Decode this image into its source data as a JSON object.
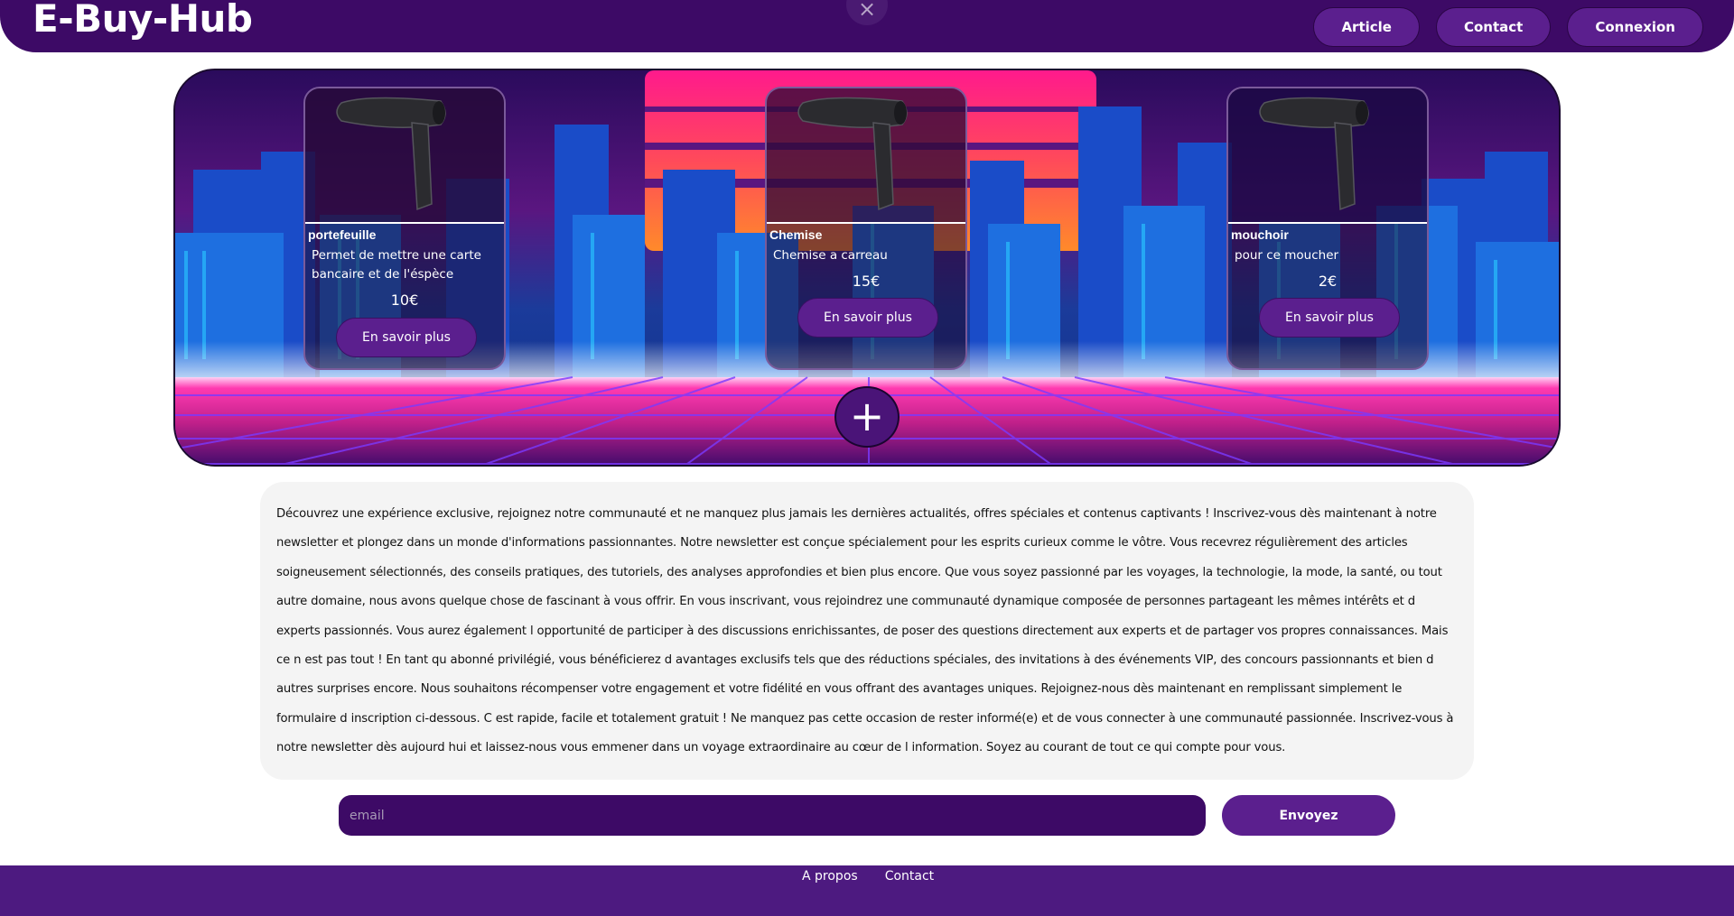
{
  "header": {
    "logo": "E-Buy-Hub",
    "close_symbol": "×",
    "nav": [
      {
        "label": "Article"
      },
      {
        "label": "Contact"
      },
      {
        "label": "Connexion"
      }
    ]
  },
  "products": [
    {
      "title": "portefeuille",
      "description": "Permet de mettre une carte bancaire et de l'éspèce",
      "price": "10€",
      "button": "En savoir plus"
    },
    {
      "title": "Chemise",
      "description": "Chemise a carreau",
      "price": "15€",
      "button": "En savoir plus"
    },
    {
      "title": "mouchoir",
      "description": "pour ce moucher",
      "price": "2€",
      "button": "En savoir plus"
    }
  ],
  "hero": {
    "plus_symbol": "+"
  },
  "newsletter": {
    "text": "Découvrez une expérience exclusive, rejoignez notre communauté et ne manquez plus jamais les dernières actualités, offres spéciales et contenus captivants ! Inscrivez-vous dès maintenant à notre newsletter et plongez dans un monde d'informations passionnantes. Notre newsletter est conçue spécialement pour les esprits curieux comme le vôtre. Vous recevrez régulièrement des articles soigneusement sélectionnés, des conseils pratiques, des tutoriels, des analyses approfondies et bien plus encore. Que vous soyez passionné par les voyages, la technologie, la mode, la santé, ou tout autre domaine, nous avons quelque chose de fascinant à vous offrir. En vous inscrivant, vous rejoindrez une communauté dynamique composée de personnes partageant les mêmes intérêts et d experts passionnés. Vous aurez également l opportunité de participer à des discussions enrichissantes, de poser des questions directement aux experts et de partager vos propres connaissances. Mais ce n est pas tout ! En tant qu abonné privilégié, vous bénéficierez d avantages exclusifs tels que des réductions spéciales, des invitations à des événements VIP, des concours passionnants et bien d autres surprises encore. Nous souhaitons récompenser votre engagement et votre fidélité en vous offrant des avantages uniques. Rejoignez-nous dès maintenant en remplissant simplement le formulaire d inscription ci-dessous. C est rapide, facile et totalement gratuit ! Ne manquez pas cette occasion de rester informé(e) et de vous connecter à une communauté passionnée. Inscrivez-vous à notre newsletter dès aujourd hui et laissez-nous vous emmener dans un voyage extraordinaire au cœur de l information. Soyez au courant de tout ce qui compte pour vous.",
    "email_placeholder": "email",
    "email_value": "",
    "submit_label": "Envoyez"
  },
  "footer": {
    "links": [
      {
        "label": "A propos"
      },
      {
        "label": "Contact"
      }
    ]
  },
  "icons": {
    "close": "close-icon",
    "plus": "plus-icon",
    "product_image": "hair-dryer-icon"
  },
  "colors": {
    "primary": "#3d0a66",
    "button": "#5b1f8e",
    "footer": "#4d1a80",
    "text_box": "#f4f4f4"
  }
}
